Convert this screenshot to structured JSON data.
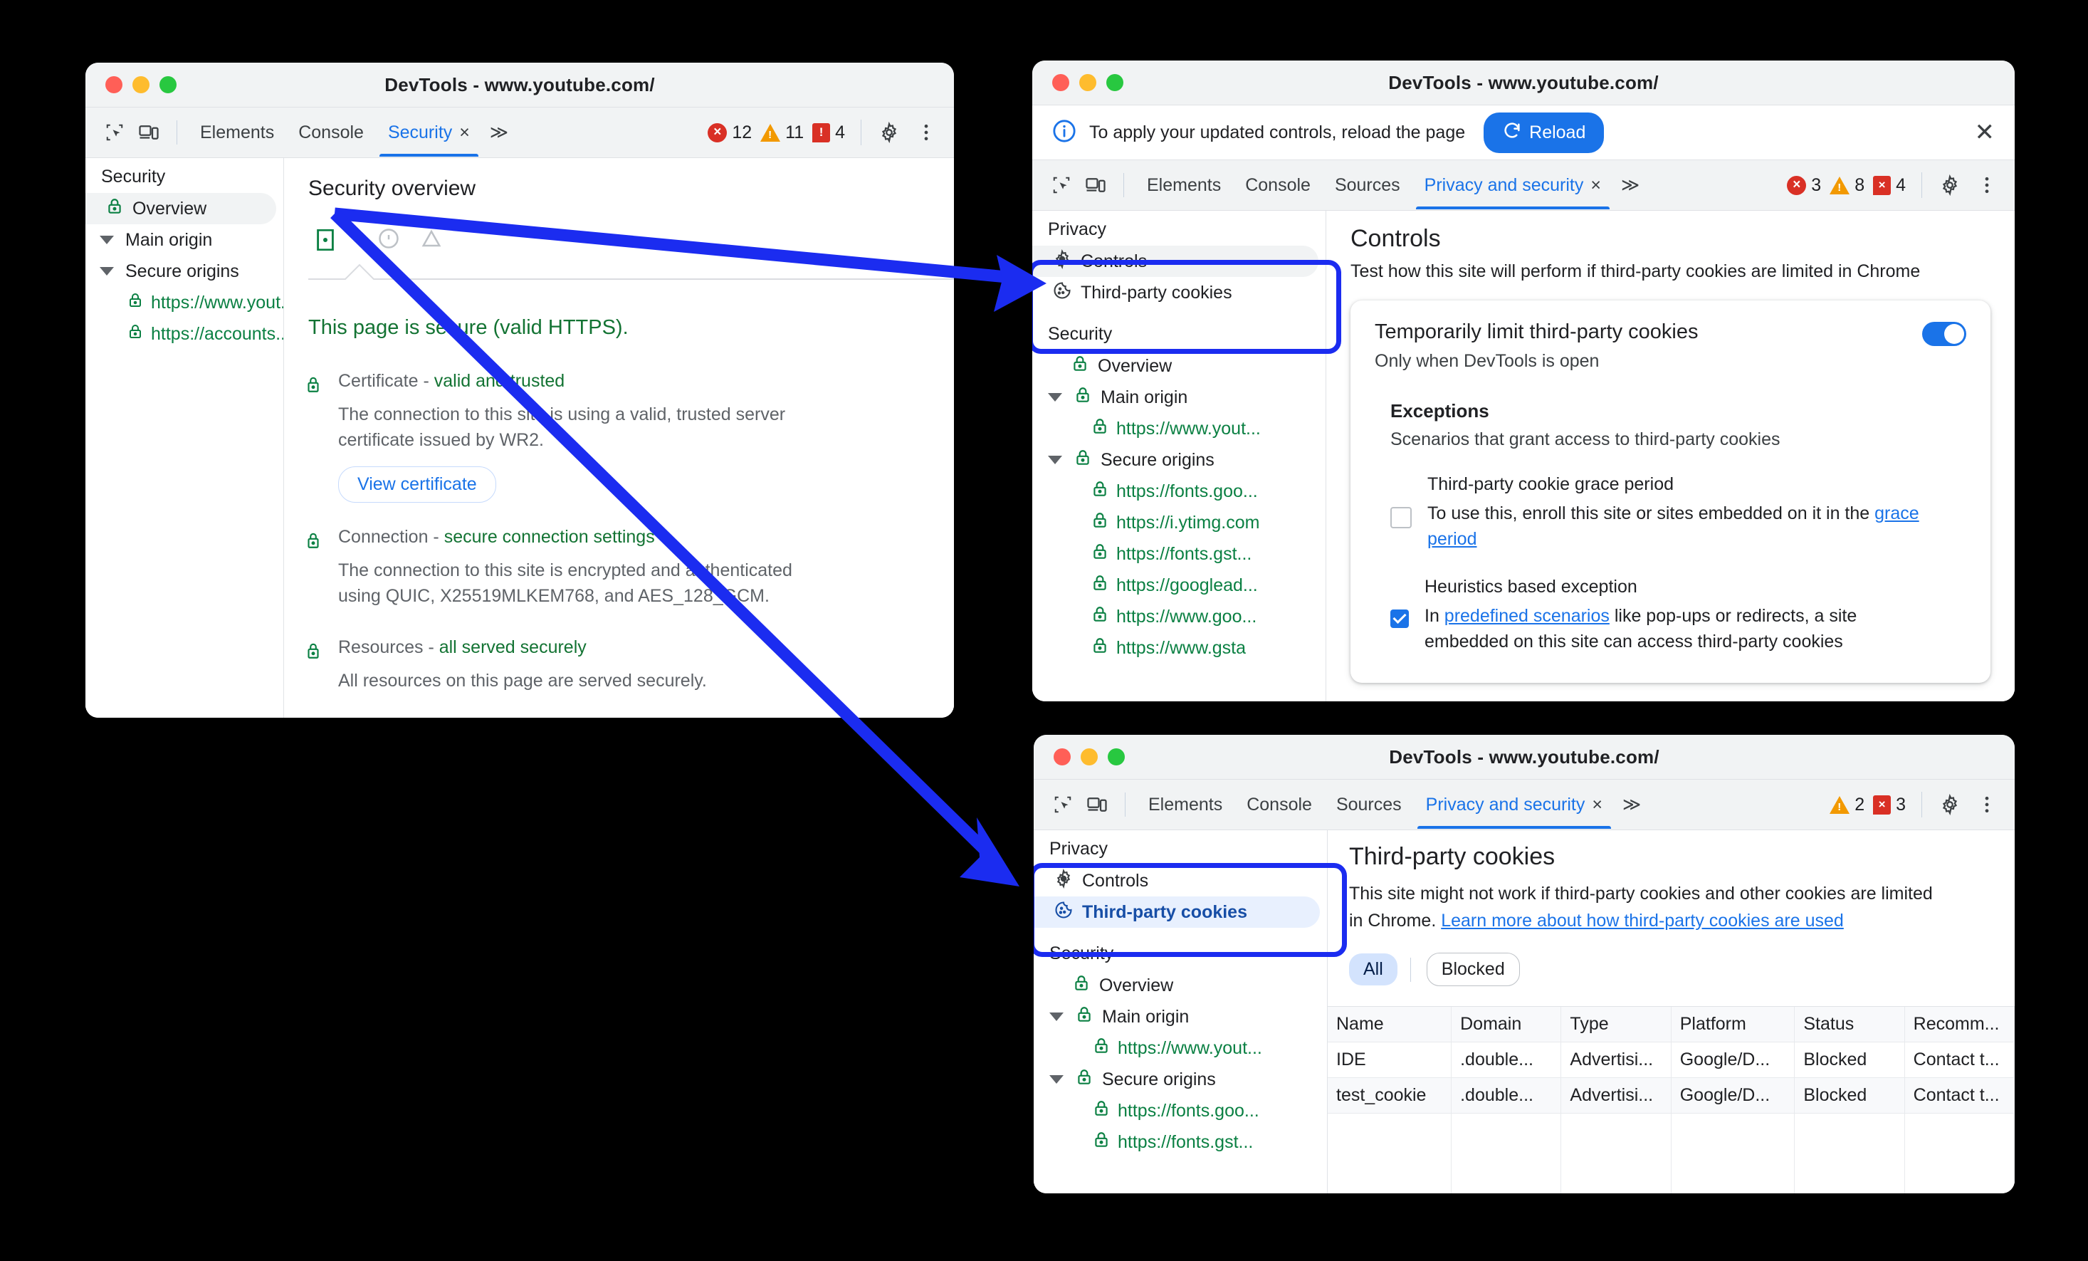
{
  "windows": {
    "left": {
      "title": "DevTools - www.youtube.com/",
      "toolbar": {
        "tabs": [
          "Elements",
          "Console"
        ],
        "active_tab": "Security",
        "close_glyph": "×",
        "overflow_glyph": "≫",
        "errors": "12",
        "warnings": "11",
        "issues": "4"
      },
      "sidebar": {
        "group": "Security",
        "items": [
          {
            "label": "Overview",
            "icon": "lock-icon",
            "selected": true
          },
          {
            "label": "Main origin",
            "icon": "triangle-expanded-icon"
          },
          {
            "label": "Secure origins",
            "icon": "triangle-expanded-icon"
          },
          {
            "label": "https://www.yout...",
            "icon": "lock-icon"
          },
          {
            "label": "https://accounts....",
            "icon": "lock-icon"
          }
        ]
      },
      "panel": {
        "title": "Security overview",
        "secure_headline": "This page is secure (valid HTTPS).",
        "sections": [
          {
            "head_label": "Certificate - ",
            "head_value": "valid and trusted",
            "desc": "The connection to this site is using a valid, trusted server certificate issued by WR2.",
            "button": "View certificate"
          },
          {
            "head_label": "Connection - ",
            "head_value": "secure connection settings",
            "desc": "The connection to this site is encrypted and authenticated using QUIC, X25519MLKEM768, and AES_128_GCM."
          },
          {
            "head_label": "Resources - ",
            "head_value": "all served securely",
            "desc": "All resources on this page are served securely."
          }
        ]
      }
    },
    "top_right": {
      "title": "DevTools - www.youtube.com/",
      "notification": {
        "icon": "info-icon",
        "text": "To apply your updated controls, reload the page",
        "button": "Reload",
        "button_icon": "refresh-icon",
        "close_glyph": "✕"
      },
      "toolbar": {
        "tabs": [
          "Elements",
          "Console",
          "Sources"
        ],
        "active_tab": "Privacy and security",
        "close_glyph": "×",
        "overflow_glyph": "≫",
        "errors": "3",
        "warnings": "8",
        "issues": "4"
      },
      "sidebar": {
        "privacy_group": "Privacy",
        "privacy_items": [
          {
            "label": "Controls",
            "icon": "gear-icon",
            "selected": true
          },
          {
            "label": "Third-party cookies",
            "icon": "cookie-icon",
            "selected": false
          }
        ],
        "security_group": "Security",
        "security_items": [
          {
            "label": "Overview",
            "icon": "lock-icon",
            "level": 1
          },
          {
            "label": "Main origin",
            "icon": "lock-icon",
            "level": 1,
            "expander": true
          },
          {
            "label": "https://www.yout...",
            "icon": "lock-icon",
            "level": 2
          },
          {
            "label": "Secure origins",
            "icon": "lock-icon",
            "level": 1,
            "expander": true
          },
          {
            "label": "https://fonts.goo...",
            "icon": "lock-icon",
            "level": 2
          },
          {
            "label": "https://i.ytimg.com",
            "icon": "lock-icon",
            "level": 2
          },
          {
            "label": "https://fonts.gst...",
            "icon": "lock-icon",
            "level": 2
          },
          {
            "label": "https://googlead...",
            "icon": "lock-icon",
            "level": 2
          },
          {
            "label": "https://www.goo...",
            "icon": "lock-icon",
            "level": 2
          },
          {
            "label": "https://www.gsta",
            "icon": "lock-icon",
            "level": 2
          }
        ]
      },
      "panel": {
        "title": "Controls",
        "subtitle": "Test how this site will perform if third-party cookies are limited in Chrome",
        "card": {
          "heading": "Temporarily limit third-party cookies",
          "sub": "Only when DevTools is open",
          "toggle_on": true,
          "exceptions_heading": "Exceptions",
          "exceptions_sub": "Scenarios that grant access to third-party cookies",
          "options": [
            {
              "title": "Third-party cookie grace period",
              "checked": false,
              "desc_before": "To use this, enroll this site or sites embedded on it in the ",
              "link": "grace period",
              "desc_after": ""
            },
            {
              "title": "Heuristics based exception",
              "checked": true,
              "desc_before": "In ",
              "link": "predefined scenarios",
              "desc_after": " like pop-ups or redirects, a site embedded on this site can access third-party cookies"
            }
          ]
        }
      }
    },
    "bottom_right": {
      "title": "DevTools - www.youtube.com/",
      "toolbar": {
        "tabs": [
          "Elements",
          "Console",
          "Sources"
        ],
        "active_tab": "Privacy and security",
        "close_glyph": "×",
        "overflow_glyph": "≫",
        "warnings": "2",
        "issues": "3"
      },
      "sidebar": {
        "privacy_group": "Privacy",
        "privacy_items": [
          {
            "label": "Controls",
            "icon": "gear-icon",
            "selected": false
          },
          {
            "label": "Third-party cookies",
            "icon": "cookie-icon",
            "selected": true
          }
        ],
        "security_group": "Security",
        "security_items": [
          {
            "label": "Overview",
            "icon": "lock-icon",
            "level": 1
          },
          {
            "label": "Main origin",
            "icon": "lock-icon",
            "level": 1,
            "expander": true
          },
          {
            "label": "https://www.yout...",
            "icon": "lock-icon",
            "level": 2
          },
          {
            "label": "Secure origins",
            "icon": "lock-icon",
            "level": 1,
            "expander": true
          },
          {
            "label": "https://fonts.goo...",
            "icon": "lock-icon",
            "level": 2
          },
          {
            "label": "https://fonts.gst...",
            "icon": "lock-icon",
            "level": 2
          }
        ]
      },
      "panel": {
        "title": "Third-party cookies",
        "desc_before": "This site might not work if third-party cookies and other cookies are limited in Chrome. ",
        "desc_link": "Learn more about how third-party cookies are used",
        "filters": [
          {
            "label": "All",
            "active": true
          },
          {
            "label": "Blocked",
            "active": false
          }
        ],
        "table": {
          "columns": [
            "Name",
            "Domain",
            "Type",
            "Platform",
            "Status",
            "Recomm..."
          ],
          "rows": [
            [
              "IDE",
              ".double...",
              "Advertisi...",
              "Google/D...",
              "Blocked",
              "Contact t..."
            ],
            [
              "test_cookie",
              ".double...",
              "Advertisi...",
              "Google/D...",
              "Blocked",
              "Contact t..."
            ]
          ]
        }
      }
    }
  },
  "colors": {
    "accent_blue": "#1a73e8",
    "arrow_blue": "#1b2cf0",
    "secure_green": "#137333",
    "error_red": "#d93025",
    "warn_orange": "#f29900"
  }
}
